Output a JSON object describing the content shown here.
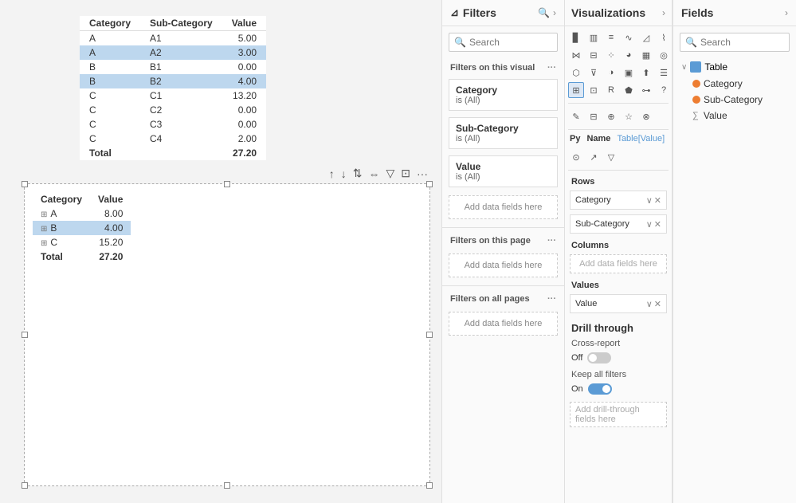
{
  "canvas": {
    "top_table": {
      "headers": [
        "Category",
        "Sub-Category",
        "Value"
      ],
      "rows": [
        {
          "cat": "A",
          "sub": "A1",
          "val": "5.00",
          "highlighted": false
        },
        {
          "cat": "A",
          "sub": "A2",
          "val": "3.00",
          "highlighted": true
        },
        {
          "cat": "B",
          "sub": "B1",
          "val": "0.00",
          "highlighted": false
        },
        {
          "cat": "B",
          "sub": "B2",
          "val": "4.00",
          "highlighted": true
        },
        {
          "cat": "C",
          "sub": "C1",
          "val": "13.20",
          "highlighted": false
        },
        {
          "cat": "C",
          "sub": "C2",
          "val": "0.00",
          "highlighted": false
        },
        {
          "cat": "C",
          "sub": "C3",
          "val": "0.00",
          "highlighted": false
        },
        {
          "cat": "C",
          "sub": "C4",
          "val": "2.00",
          "highlighted": false
        }
      ],
      "footer": {
        "label": "Total",
        "val": "27.20"
      }
    },
    "matrix": {
      "headers": [
        "Category",
        "Value"
      ],
      "rows": [
        {
          "cat": "A",
          "val": "8.00",
          "highlighted": false
        },
        {
          "cat": "B",
          "val": "4.00",
          "highlighted": true
        },
        {
          "cat": "C",
          "val": "15.20",
          "highlighted": false
        }
      ],
      "footer": {
        "label": "Total",
        "val": "27.20"
      }
    }
  },
  "filters": {
    "title": "Filters",
    "search_placeholder": "Search",
    "section_visual": "Filters on this visual",
    "section_page": "Filters on this page",
    "section_all": "Filters on all pages",
    "filter_cards": [
      {
        "title": "Category",
        "sub": "is (All)"
      },
      {
        "title": "Sub-Category",
        "sub": "is (All)"
      },
      {
        "title": "Value",
        "sub": "is (All)"
      }
    ],
    "add_fields_label": "Add data fields here"
  },
  "visualizations": {
    "title": "Visualizations",
    "rows_label": "Rows",
    "columns_label": "Columns",
    "values_label": "Values",
    "drill_title": "Drill through",
    "cross_report_label": "Cross-report",
    "cross_report_state": "Off",
    "keep_all_filters_label": "Keep all filters",
    "keep_all_state": "On",
    "add_drill_label": "Add drill-through fields here",
    "add_data_label": "Add data fields here",
    "rows_fields": [
      "Category",
      "Sub-Category"
    ],
    "values_fields": [
      "Value"
    ],
    "py_label": "Py",
    "name_label": "Name",
    "table_label": "Table[Value]"
  },
  "fields": {
    "title": "Fields",
    "search_placeholder": "Search",
    "table_name": "Table",
    "items": [
      {
        "name": "Category",
        "type": "text",
        "color": "#ed7d31"
      },
      {
        "name": "Sub-Category",
        "type": "text",
        "color": "#ed7d31"
      },
      {
        "name": "Value",
        "type": "numeric",
        "color": "#888"
      }
    ]
  }
}
